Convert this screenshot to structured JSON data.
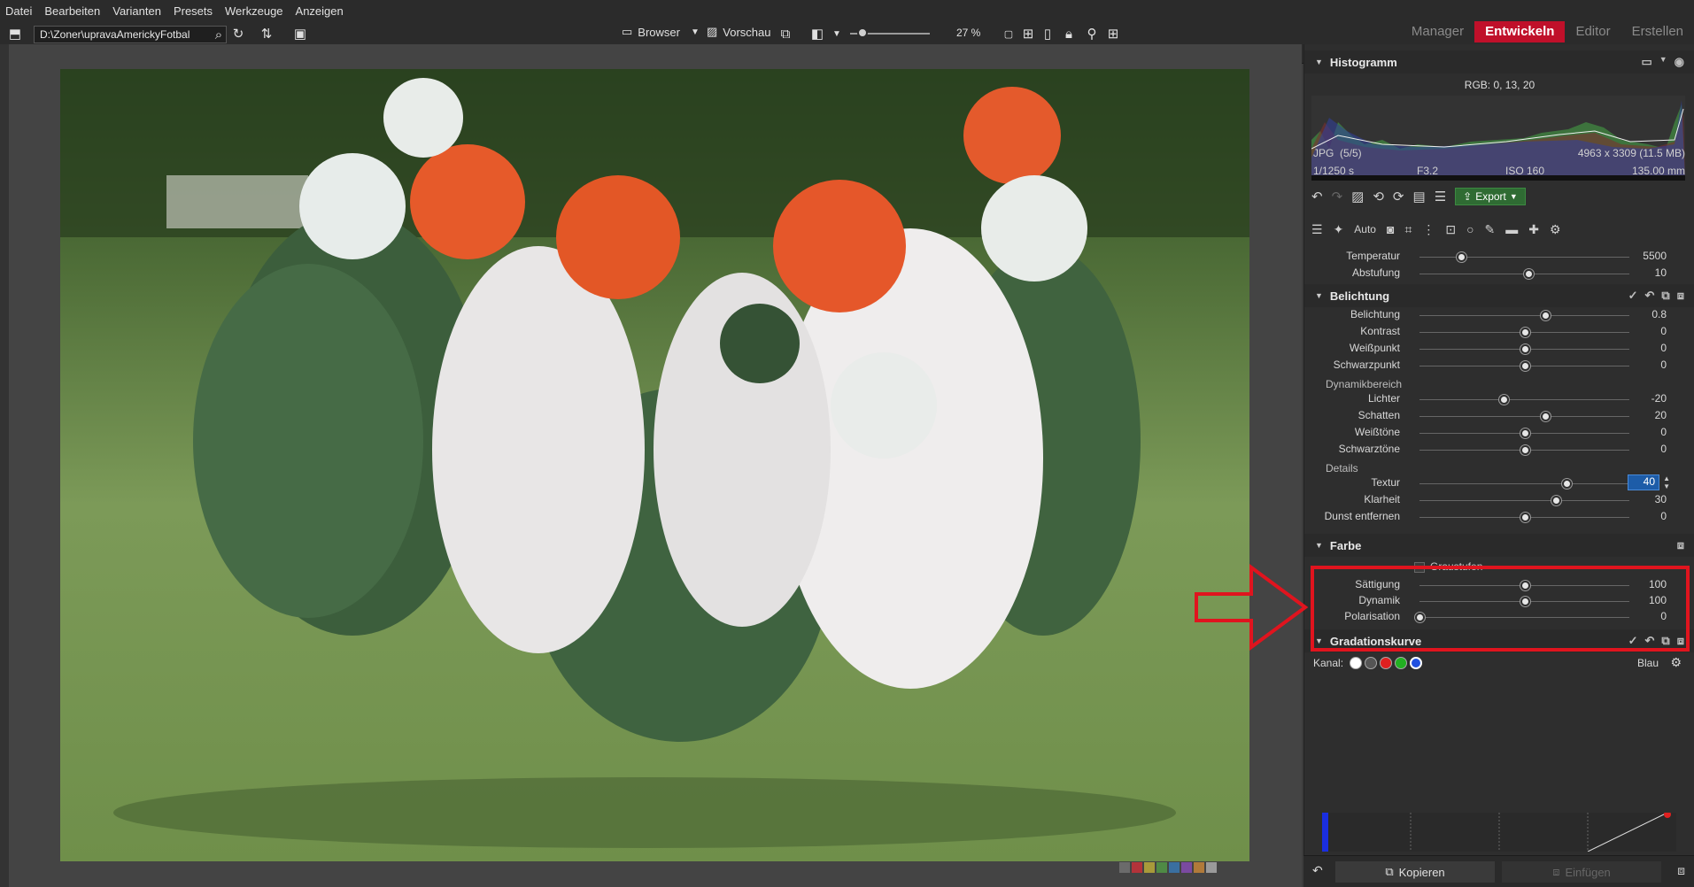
{
  "menu": [
    "Datei",
    "Bearbeiten",
    "Varianten",
    "Presets",
    "Werkzeuge",
    "Anzeigen"
  ],
  "toolbar": {
    "path": "D:\\Zoner\\upravaAmerickyFotbal",
    "browser_label": "Browser",
    "preview_label": "Vorschau",
    "zoom_level": "27 %"
  },
  "modes": [
    "Manager",
    "Entwickeln",
    "Editor",
    "Erstellen"
  ],
  "active_mode": "Entwickeln",
  "photo": {
    "rating": "☆☆☆☆☆",
    "color_labels": [
      "#6b6b6b",
      "#b3333a",
      "#a89a3a",
      "#4f8a45",
      "#3a6fa0",
      "#7a4aa0",
      "#b07a3a",
      "#9a9a9a"
    ]
  },
  "histogram": {
    "title": "Histogramm",
    "rgb": "RGB:  0,  13,  20"
  },
  "file_info": {
    "format": "JPG",
    "index": "(5/5)",
    "dims": "4963 x 3309 (11.5 MB)",
    "shutter": "1/1250 s",
    "aperture": "F3.2",
    "iso": "ISO 160",
    "focal": "135.00 mm"
  },
  "edit_toolbar": {
    "export_label": "Export",
    "auto_label": "Auto"
  },
  "white_balance": {
    "rows": [
      {
        "label": "Temperatur",
        "value": "5500",
        "pos": 0.2
      },
      {
        "label": "Abstufung",
        "value": "10",
        "pos": 0.52
      }
    ]
  },
  "exposure": {
    "title": "Belichtung",
    "rows": [
      {
        "label": "Belichtung",
        "value": "0.8",
        "pos": 0.6
      },
      {
        "label": "Kontrast",
        "value": "0",
        "pos": 0.5
      },
      {
        "label": "Weißpunkt",
        "value": "0",
        "pos": 0.5
      },
      {
        "label": "Schwarzpunkt",
        "value": "0",
        "pos": 0.5
      }
    ],
    "dynamic_title": "Dynamikbereich",
    "dynamic_rows": [
      {
        "label": "Lichter",
        "value": "-20",
        "pos": 0.4
      },
      {
        "label": "Schatten",
        "value": "20",
        "pos": 0.6
      },
      {
        "label": "Weißtöne",
        "value": "0",
        "pos": 0.5
      },
      {
        "label": "Schwarztöne",
        "value": "0",
        "pos": 0.5
      }
    ],
    "details_title": "Details",
    "details_rows": [
      {
        "label": "Textur",
        "value": "40",
        "pos": 0.7
      },
      {
        "label": "Klarheit",
        "value": "30",
        "pos": 0.65
      },
      {
        "label": "Dunst entfernen",
        "value": "0",
        "pos": 0.5
      }
    ]
  },
  "color": {
    "title": "Farbe",
    "grayscale_label": "Graustufen",
    "rows": [
      {
        "label": "Sättigung",
        "value": "100",
        "pos": 0.5
      },
      {
        "label": "Dynamik",
        "value": "100",
        "pos": 0.5
      },
      {
        "label": "Polarisation",
        "value": "0",
        "pos": 0.0
      }
    ]
  },
  "curve": {
    "title": "Gradationskurve",
    "channel_label": "Kanal:",
    "channel_value": "Blau"
  },
  "bottom": {
    "copy_label": "Kopieren",
    "paste_label": "Einfügen"
  }
}
